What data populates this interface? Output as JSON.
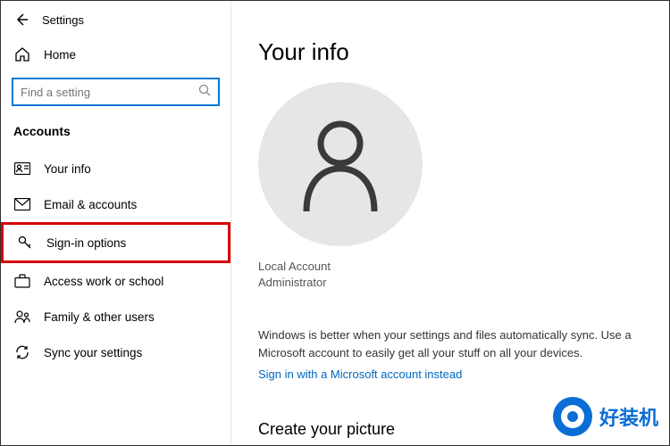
{
  "header": {
    "title": "Settings"
  },
  "nav": {
    "home": "Home",
    "section": "Accounts",
    "items": [
      {
        "label": "Your info"
      },
      {
        "label": "Email & accounts"
      },
      {
        "label": "Sign-in options"
      },
      {
        "label": "Access work or school"
      },
      {
        "label": "Family & other users"
      },
      {
        "label": "Sync your settings"
      }
    ]
  },
  "search": {
    "placeholder": "Find a setting"
  },
  "main": {
    "title": "Your info",
    "account_type": "Local Account",
    "account_role": "Administrator",
    "sync_text": "Windows is better when your settings and files automatically sync. Use a Microsoft account to easily get all your stuff on all your devices.",
    "ms_link": "Sign in with a Microsoft account instead",
    "picture_heading": "Create your picture"
  },
  "watermark": {
    "text": "好装机"
  }
}
